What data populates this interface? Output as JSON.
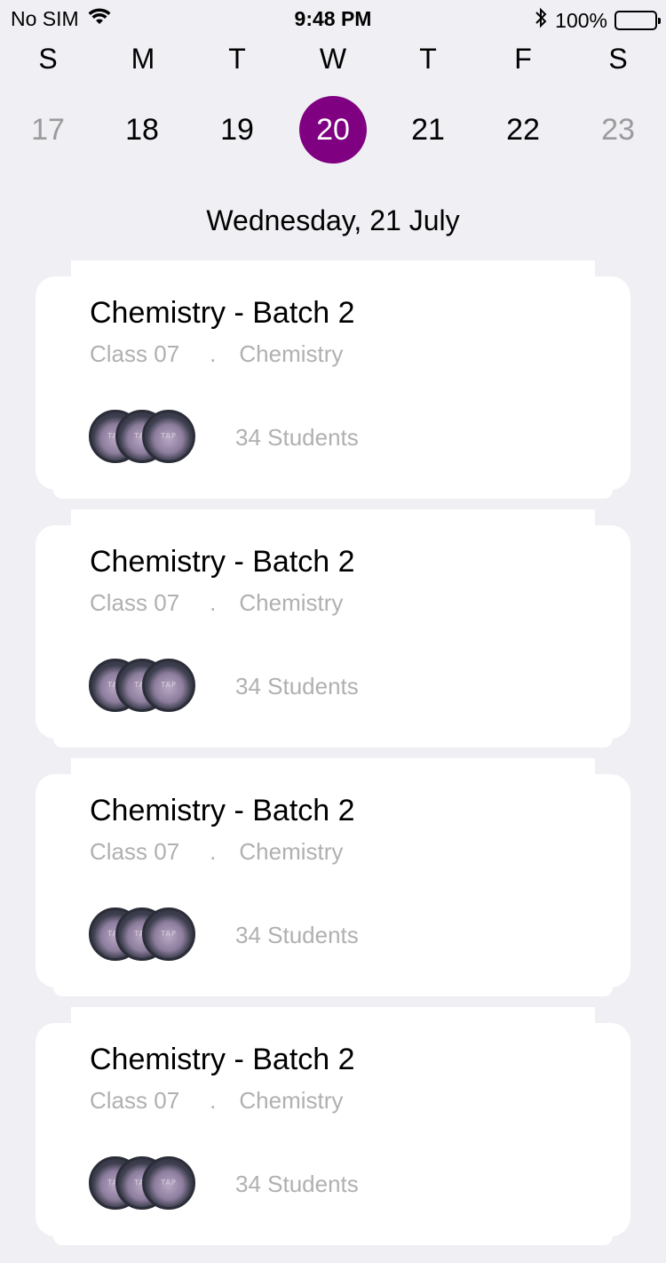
{
  "status": {
    "carrier": "No SIM",
    "time": "9:48 PM",
    "battery": "100%"
  },
  "calendar": {
    "weekdays": [
      "S",
      "M",
      "T",
      "W",
      "T",
      "F",
      "S"
    ],
    "dates": [
      "17",
      "18",
      "19",
      "20",
      "21",
      "22",
      "23"
    ],
    "selected_date": "20",
    "selected_color": "#7f0080"
  },
  "day_title": "Wednesday, 21 July",
  "classes": [
    {
      "title": "Chemistry - Batch 2",
      "class_name": "Class 07",
      "separator": ".",
      "subject": "Chemistry",
      "students": "34 Students"
    },
    {
      "title": "Chemistry - Batch 2",
      "class_name": "Class 07",
      "separator": ".",
      "subject": "Chemistry",
      "students": "34 Students"
    },
    {
      "title": "Chemistry - Batch 2",
      "class_name": "Class 07",
      "separator": ".",
      "subject": "Chemistry",
      "students": "34 Students"
    },
    {
      "title": "Chemistry - Batch 2",
      "class_name": "Class 07",
      "separator": ".",
      "subject": "Chemistry",
      "students": "34 Students"
    }
  ]
}
